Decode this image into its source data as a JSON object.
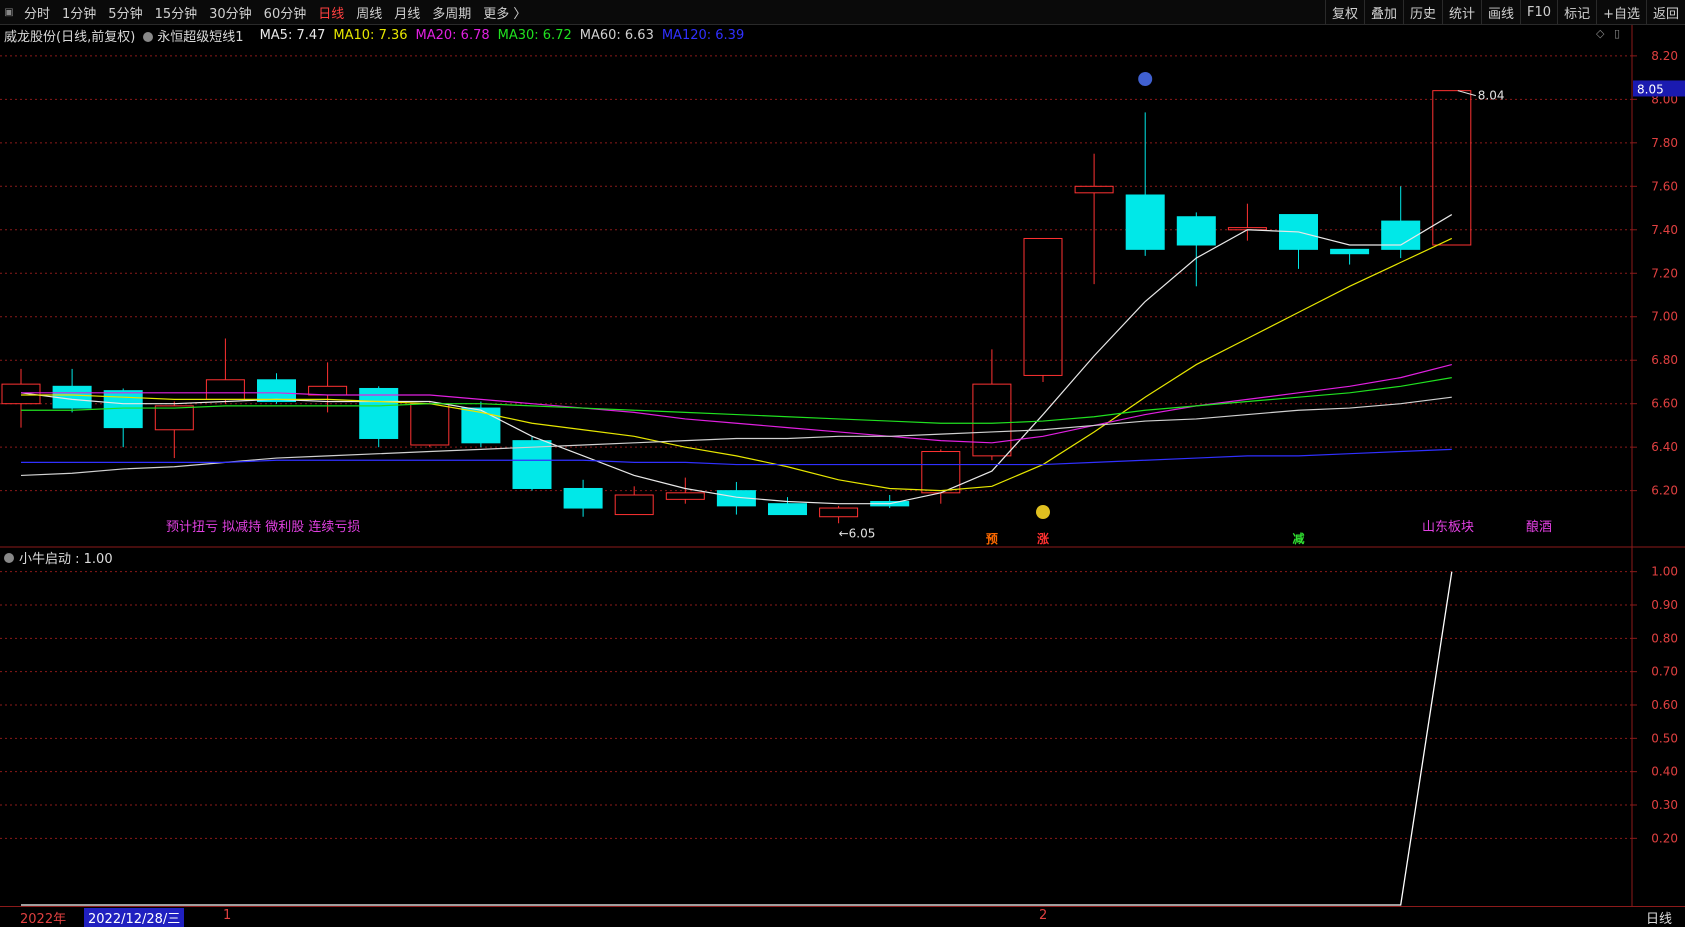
{
  "toolbar": {
    "tabs": [
      "分时",
      "1分钟",
      "5分钟",
      "15分钟",
      "30分钟",
      "60分钟",
      "日线",
      "周线",
      "月线",
      "多周期",
      "更多 〉"
    ],
    "active_tab": "日线",
    "tools": [
      "复权",
      "叠加",
      "历史",
      "统计",
      "画线",
      "F10",
      "标记",
      "+自选",
      "返回"
    ]
  },
  "legend": {
    "stock": "威龙股份(日线,前复权)",
    "indicator": "永恒超级短线1",
    "items": [
      {
        "label": "MA5: 7.47",
        "color": "#e8e8e8"
      },
      {
        "label": "MA10: 7.36",
        "color": "#e6e600"
      },
      {
        "label": "MA20: 6.78",
        "color": "#e020e0"
      },
      {
        "label": "MA30: 6.72",
        "color": "#20e020"
      },
      {
        "label": "MA60: 6.63",
        "color": "#d0d0d0"
      },
      {
        "label": "MA120: 6.39",
        "color": "#3030ff"
      }
    ]
  },
  "sub_legend": "小牛启动 : 1.00",
  "annotations": {
    "high_label": "8.04",
    "low_label": "6.05",
    "price_tag": "8.05",
    "events": [
      {
        "text": "预计扭亏 拟减持 微利股 连续亏损",
        "color": "#e040e0"
      },
      {
        "text": "山东板块",
        "color": "#e040e0"
      },
      {
        "text": "酿酒",
        "color": "#e040e0"
      }
    ],
    "markers": [
      {
        "text": "预",
        "color": "#ff6a00"
      },
      {
        "text": "涨",
        "color": "#ff3030"
      },
      {
        "text": "减",
        "color": "#30e030"
      }
    ]
  },
  "bottom": {
    "year": "2022年",
    "cursor_date": "2022/12/28/三",
    "month1": "1",
    "month2": "2",
    "period": "日线"
  },
  "colors": {
    "up": "#ff3232",
    "down": "#00e8e8",
    "grid": "#8b1a1a",
    "axis_text": "#e04040"
  },
  "chart_data": {
    "type": "candlestick",
    "ylim": [
      5.95,
      8.25
    ],
    "y_ticks": [
      6.2,
      6.4,
      6.6,
      6.8,
      7.0,
      7.2,
      7.4,
      7.6,
      7.8,
      8.0,
      8.2
    ],
    "candles": [
      {
        "o": 6.6,
        "h": 6.76,
        "l": 6.49,
        "c": 6.69
      },
      {
        "o": 6.68,
        "h": 6.76,
        "l": 6.56,
        "c": 6.58
      },
      {
        "o": 6.66,
        "h": 6.67,
        "l": 6.4,
        "c": 6.49
      },
      {
        "o": 6.48,
        "h": 6.61,
        "l": 6.35,
        "c": 6.59
      },
      {
        "o": 6.62,
        "h": 6.9,
        "l": 6.6,
        "c": 6.71
      },
      {
        "o": 6.71,
        "h": 6.74,
        "l": 6.6,
        "c": 6.61
      },
      {
        "o": 6.64,
        "h": 6.79,
        "l": 6.56,
        "c": 6.68
      },
      {
        "o": 6.67,
        "h": 6.68,
        "l": 6.4,
        "c": 6.44
      },
      {
        "o": 6.41,
        "h": 6.61,
        "l": 6.4,
        "c": 6.6
      },
      {
        "o": 6.58,
        "h": 6.61,
        "l": 6.4,
        "c": 6.42
      },
      {
        "o": 6.43,
        "h": 6.45,
        "l": 6.2,
        "c": 6.21
      },
      {
        "o": 6.21,
        "h": 6.25,
        "l": 6.08,
        "c": 6.12
      },
      {
        "o": 6.09,
        "h": 6.22,
        "l": 6.09,
        "c": 6.18
      },
      {
        "o": 6.16,
        "h": 6.26,
        "l": 6.14,
        "c": 6.19
      },
      {
        "o": 6.2,
        "h": 6.24,
        "l": 6.09,
        "c": 6.13
      },
      {
        "o": 6.14,
        "h": 6.17,
        "l": 6.09,
        "c": 6.09
      },
      {
        "o": 6.08,
        "h": 6.13,
        "l": 6.05,
        "c": 6.12
      },
      {
        "o": 6.15,
        "h": 6.18,
        "l": 6.12,
        "c": 6.13
      },
      {
        "o": 6.19,
        "h": 6.39,
        "l": 6.14,
        "c": 6.38
      },
      {
        "o": 6.36,
        "h": 6.85,
        "l": 6.34,
        "c": 6.69
      },
      {
        "o": 6.73,
        "h": 7.36,
        "l": 6.7,
        "c": 7.36
      },
      {
        "o": 7.57,
        "h": 7.75,
        "l": 7.15,
        "c": 7.6
      },
      {
        "o": 7.56,
        "h": 7.94,
        "l": 7.28,
        "c": 7.31
      },
      {
        "o": 7.46,
        "h": 7.48,
        "l": 7.14,
        "c": 7.33
      },
      {
        "o": 7.4,
        "h": 7.52,
        "l": 7.35,
        "c": 7.41
      },
      {
        "o": 7.47,
        "h": 7.47,
        "l": 7.22,
        "c": 7.31
      },
      {
        "o": 7.31,
        "h": 7.31,
        "l": 7.24,
        "c": 7.29
      },
      {
        "o": 7.44,
        "h": 7.6,
        "l": 7.27,
        "c": 7.31
      },
      {
        "o": 7.33,
        "h": 8.04,
        "l": 7.33,
        "c": 8.04
      }
    ],
    "ma": {
      "MA5": [
        6.65,
        6.62,
        6.6,
        6.6,
        6.61,
        6.62,
        6.61,
        6.61,
        6.61,
        6.57,
        6.45,
        6.36,
        6.27,
        6.21,
        6.17,
        6.15,
        6.14,
        6.14,
        6.19,
        6.29,
        6.55,
        6.82,
        7.07,
        7.27,
        7.4,
        7.39,
        7.33,
        7.33,
        7.47
      ],
      "MA10": [
        6.64,
        6.64,
        6.63,
        6.62,
        6.62,
        6.62,
        6.62,
        6.61,
        6.6,
        6.56,
        6.51,
        6.48,
        6.45,
        6.4,
        6.36,
        6.31,
        6.25,
        6.21,
        6.2,
        6.22,
        6.32,
        6.47,
        6.63,
        6.78,
        6.9,
        7.02,
        7.14,
        7.25,
        7.36
      ],
      "MA20": [
        6.65,
        6.65,
        6.65,
        6.65,
        6.65,
        6.65,
        6.64,
        6.64,
        6.64,
        6.62,
        6.6,
        6.58,
        6.56,
        6.53,
        6.51,
        6.49,
        6.47,
        6.45,
        6.43,
        6.42,
        6.45,
        6.5,
        6.55,
        6.59,
        6.62,
        6.65,
        6.68,
        6.72,
        6.78
      ],
      "MA30": [
        6.57,
        6.57,
        6.58,
        6.58,
        6.59,
        6.59,
        6.59,
        6.59,
        6.6,
        6.6,
        6.59,
        6.58,
        6.57,
        6.56,
        6.55,
        6.54,
        6.53,
        6.52,
        6.51,
        6.51,
        6.52,
        6.54,
        6.57,
        6.59,
        6.61,
        6.63,
        6.65,
        6.68,
        6.72
      ],
      "MA60": [
        6.27,
        6.28,
        6.3,
        6.31,
        6.33,
        6.35,
        6.36,
        6.37,
        6.38,
        6.39,
        6.4,
        6.41,
        6.42,
        6.43,
        6.44,
        6.44,
        6.45,
        6.45,
        6.46,
        6.47,
        6.48,
        6.5,
        6.52,
        6.53,
        6.55,
        6.57,
        6.58,
        6.6,
        6.63
      ],
      "MA120": [
        6.33,
        6.33,
        6.33,
        6.33,
        6.33,
        6.34,
        6.34,
        6.34,
        6.34,
        6.34,
        6.34,
        6.34,
        6.33,
        6.33,
        6.32,
        6.32,
        6.32,
        6.32,
        6.32,
        6.32,
        6.32,
        6.33,
        6.34,
        6.35,
        6.36,
        6.36,
        6.37,
        6.38,
        6.39
      ]
    },
    "sub": {
      "name": "小牛启动",
      "ylim": [
        0.0,
        1.05
      ],
      "y_ticks": [
        0.2,
        0.3,
        0.4,
        0.5,
        0.6,
        0.7,
        0.8,
        0.9,
        1.0
      ],
      "values": [
        0,
        0,
        0,
        0,
        0,
        0,
        0,
        0,
        0,
        0,
        0,
        0,
        0,
        0,
        0,
        0,
        0,
        0,
        0,
        0,
        0,
        0,
        0,
        0,
        0,
        0,
        0,
        0,
        1
      ]
    }
  }
}
